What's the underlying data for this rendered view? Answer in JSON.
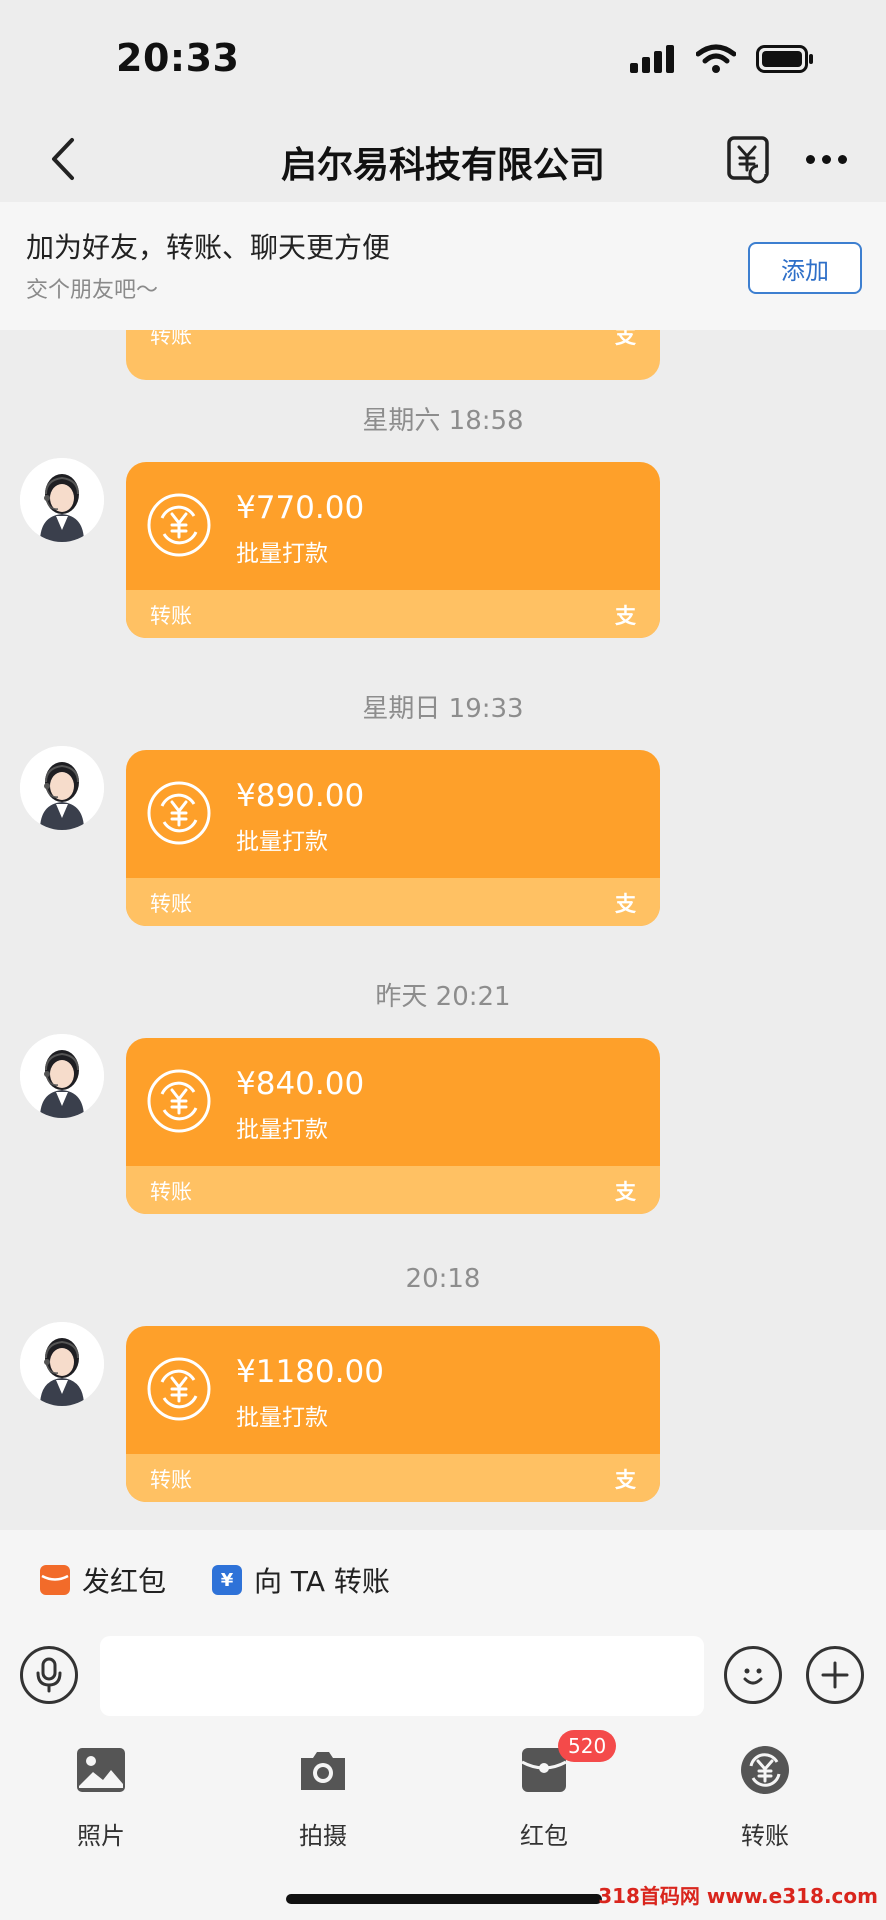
{
  "status_bar": {
    "time": "20:33"
  },
  "nav": {
    "title": "启尔易科技有限公司"
  },
  "friend_banner": {
    "title": "加为好友，转账、聊天更方便",
    "subtitle": "交个朋友吧～",
    "add_button": "添加"
  },
  "partial_card": {
    "label": "转账",
    "mark": "支"
  },
  "messages": [
    {
      "time": "星期六 18:58",
      "amount": "¥770.00",
      "desc": "批量打款",
      "label": "转账",
      "mark": "支"
    },
    {
      "time": "星期日 19:33",
      "amount": "¥890.00",
      "desc": "批量打款",
      "label": "转账",
      "mark": "支"
    },
    {
      "time": "昨天 20:21",
      "amount": "¥840.00",
      "desc": "批量打款",
      "label": "转账",
      "mark": "支"
    },
    {
      "time": "20:18",
      "amount": "¥1180.00",
      "desc": "批量打款",
      "label": "转账",
      "mark": "支"
    }
  ],
  "quick_actions": {
    "red_packet": "发红包",
    "transfer": "向 TA 转账"
  },
  "tools": [
    {
      "label": "照片",
      "icon": "photo-icon"
    },
    {
      "label": "拍摄",
      "icon": "camera-icon"
    },
    {
      "label": "红包",
      "icon": "red-packet-icon",
      "badge": "520"
    },
    {
      "label": "转账",
      "icon": "transfer-icon"
    }
  ],
  "watermark": "318首码网 www.e318.com",
  "colors": {
    "card": "#fea02a",
    "card_footer": "#ffc163",
    "accent_blue": "#2e6fc8",
    "badge": "#f44a4a",
    "background": "#ededed"
  }
}
